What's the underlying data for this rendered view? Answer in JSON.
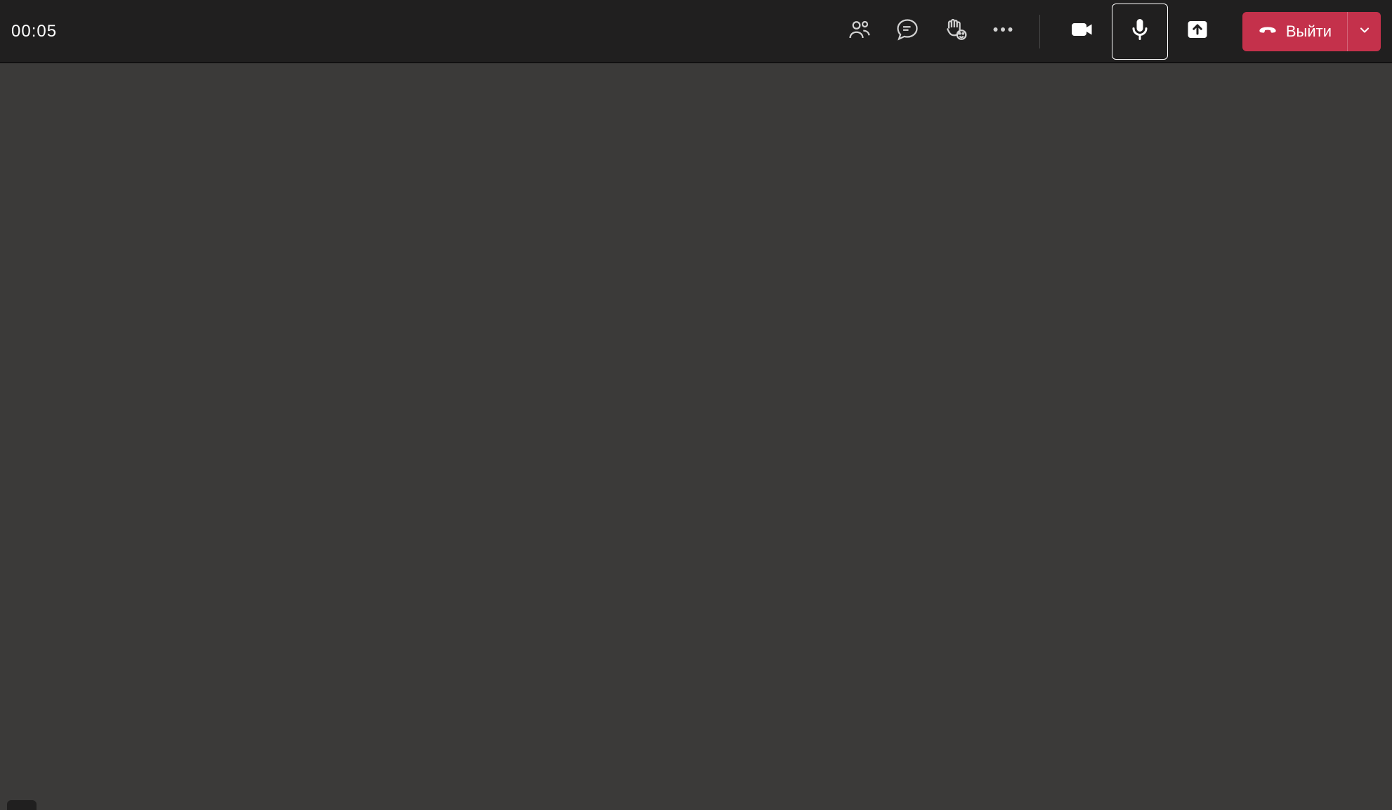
{
  "toolbar": {
    "timer": "00:05",
    "leave_label": "Выйти",
    "icons": {
      "people": "people-icon",
      "chat": "chat-icon",
      "reactions": "raise-hand-reactions-icon",
      "more": "more-options-icon",
      "camera": "camera-icon",
      "mic": "microphone-icon",
      "share": "share-screen-icon",
      "hangup": "hangup-icon",
      "chevron": "chevron-down-icon"
    }
  },
  "colors": {
    "toolbar_bg": "#201f1f",
    "main_bg": "#3b3a39",
    "leave_bg": "#c4314b",
    "text": "#ffffff",
    "icon": "#d1d1d1"
  }
}
